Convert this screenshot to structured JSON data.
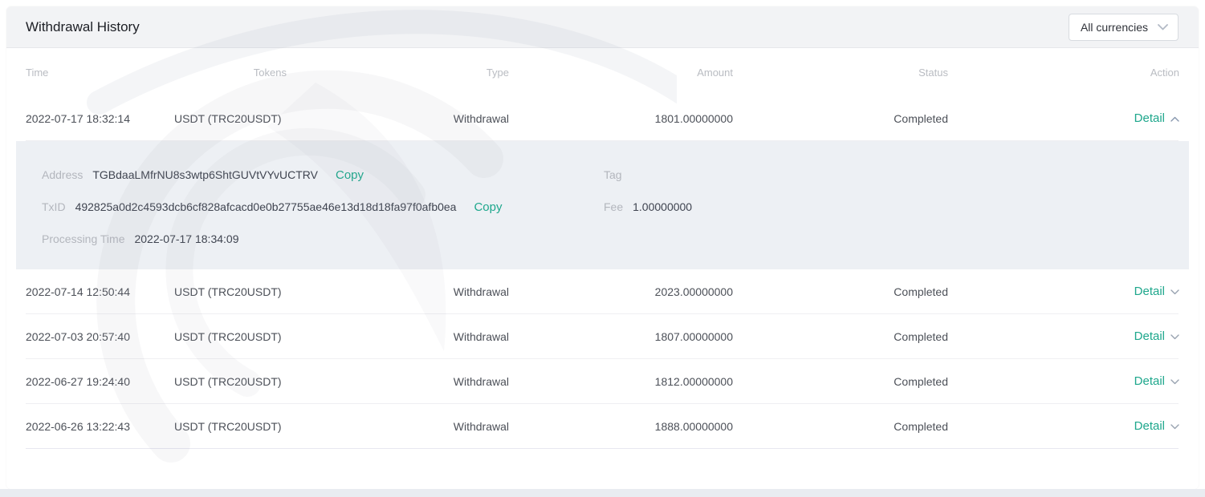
{
  "card": {
    "title": "Withdrawal History",
    "currency_filter": {
      "value": "All currencies",
      "icon": "chevron-down-icon"
    }
  },
  "table": {
    "columns": {
      "time": "Time",
      "tokens": "Tokens",
      "type": "Type",
      "amount": "Amount",
      "status": "Status",
      "action": "Action"
    },
    "action_label": "Detail",
    "rows": [
      {
        "time": "2022-07-17 18:32:14",
        "tokens": "USDT (TRC20USDT)",
        "type": "Withdrawal",
        "amount": "1801.00000000",
        "status": "Completed",
        "expanded": true
      },
      {
        "time": "2022-07-14 12:50:44",
        "tokens": "USDT (TRC20USDT)",
        "type": "Withdrawal",
        "amount": "2023.00000000",
        "status": "Completed",
        "expanded": false
      },
      {
        "time": "2022-07-03 20:57:40",
        "tokens": "USDT (TRC20USDT)",
        "type": "Withdrawal",
        "amount": "1807.00000000",
        "status": "Completed",
        "expanded": false
      },
      {
        "time": "2022-06-27 19:24:40",
        "tokens": "USDT (TRC20USDT)",
        "type": "Withdrawal",
        "amount": "1812.00000000",
        "status": "Completed",
        "expanded": false
      },
      {
        "time": "2022-06-26 13:22:43",
        "tokens": "USDT (TRC20USDT)",
        "type": "Withdrawal",
        "amount": "1888.00000000",
        "status": "Completed",
        "expanded": false
      }
    ]
  },
  "detail_panel": {
    "address_label": "Address",
    "address_value": "TGBdaaLMfrNU8s3wtp6ShtGUVtVYvUCTRV",
    "copy_label": "Copy",
    "txid_label": "TxID",
    "txid_value": "492825a0d2c4593dcb6cf828afcacd0e0b27755ae46e13d18d18fa97f0afb0ea",
    "processing_time_label": "Processing Time",
    "processing_time_value": "2022-07-17 18:34:09",
    "tag_label": "Tag",
    "tag_value": "",
    "fee_label": "Fee",
    "fee_value": "1.00000000"
  },
  "colors": {
    "accent": "#1ea78c",
    "card_header_bg": "#f2f3f5",
    "detail_panel_bg": "#edf0f4"
  }
}
